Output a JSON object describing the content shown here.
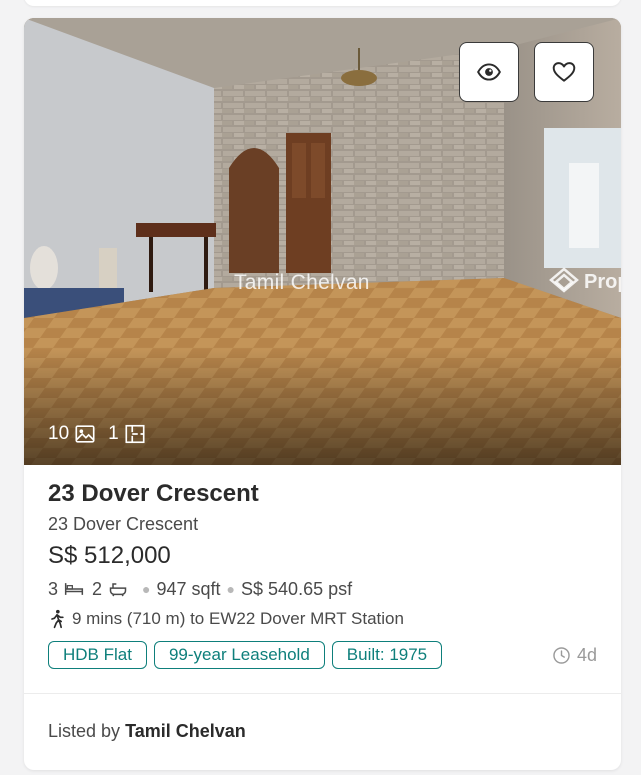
{
  "listing": {
    "photo": {
      "image_count": "10",
      "floorplan_count": "1",
      "watermark_name": "Tamil Chelvan",
      "watermark_brand": "Prop"
    },
    "title": "23 Dover Crescent",
    "address": "23 Dover Crescent",
    "price": "S$ 512,000",
    "beds": "3",
    "baths": "2",
    "area": "947 sqft",
    "psf": "S$ 540.65 psf",
    "mrt": "9 mins (710 m) to EW22 Dover MRT Station",
    "tags": [
      "HDB Flat",
      "99-year Leasehold",
      "Built: 1975"
    ],
    "age": "4d",
    "listed_by_prefix": "Listed by",
    "agent_name": "Tamil Chelvan"
  },
  "icons": {
    "view": "eye-icon",
    "favorite": "heart-icon",
    "images": "image-icon",
    "floorplan": "floorplan-icon",
    "bed": "bed-icon",
    "bath": "bath-icon",
    "walk": "walking-icon",
    "clock": "clock-icon"
  },
  "colors": {
    "accent": "#0e7f7b",
    "text": "#2b2b2b",
    "muted": "#9a9a9a"
  }
}
